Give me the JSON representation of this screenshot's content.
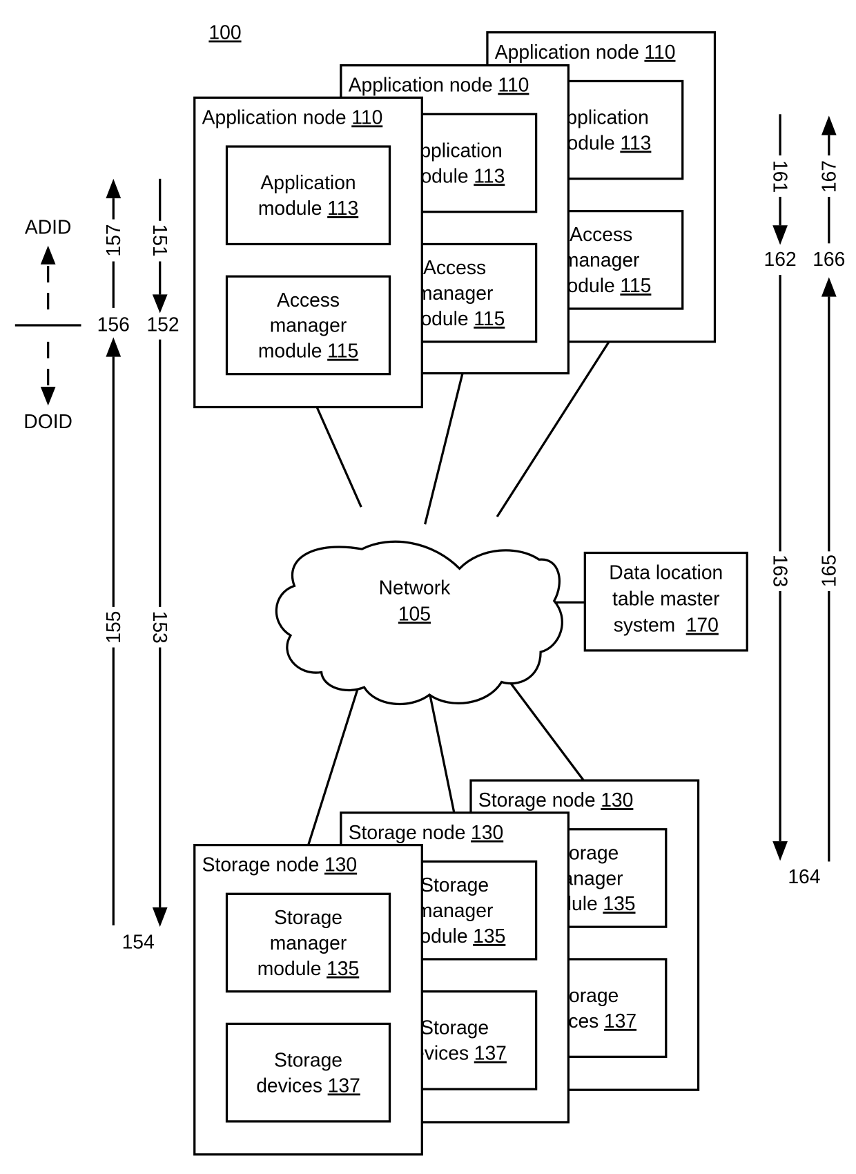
{
  "figure": {
    "figure_ref": "100",
    "application_nodes": [
      {
        "title": "Application node",
        "ref": "110",
        "modules": [
          {
            "lines": [
              "Application",
              "module"
            ],
            "ref": "113"
          },
          {
            "lines": [
              "Access",
              "manager",
              "module"
            ],
            "ref": "115"
          }
        ]
      },
      {
        "title": "Application node",
        "ref": "110",
        "modules": [
          {
            "lines": [
              "Application",
              "module"
            ],
            "ref": "113"
          },
          {
            "lines": [
              "Access",
              "manager",
              "module"
            ],
            "ref": "115"
          }
        ]
      },
      {
        "title": "Application node",
        "ref": "110",
        "modules": [
          {
            "lines": [
              "Application",
              "module"
            ],
            "ref": "113"
          },
          {
            "lines": [
              "Access",
              "manager",
              "module"
            ],
            "ref": "115"
          }
        ]
      }
    ],
    "network": {
      "label": "Network",
      "ref": "105"
    },
    "data_location": {
      "lines": [
        "Data location",
        "table master",
        "system"
      ],
      "ref": "170"
    },
    "storage_nodes": [
      {
        "title": "Storage node",
        "ref": "130",
        "modules": [
          {
            "lines": [
              "Storage",
              "manager",
              "module"
            ],
            "ref": "135"
          },
          {
            "lines": [
              "Storage",
              "devices"
            ],
            "ref": "137"
          }
        ]
      },
      {
        "title": "Storage node",
        "ref": "130",
        "modules": [
          {
            "lines": [
              "Storage",
              "manager",
              "module"
            ],
            "ref": "135"
          },
          {
            "lines": [
              "Storage",
              "devices"
            ],
            "ref": "137"
          }
        ]
      },
      {
        "title": "Storage node",
        "ref": "130",
        "modules": [
          {
            "lines": [
              "Storage",
              "manager",
              "module"
            ],
            "ref": "135"
          },
          {
            "lines": [
              "Storage",
              "devices"
            ],
            "ref": "137"
          }
        ]
      }
    ],
    "legend": {
      "up_label": "ADID",
      "down_label": "DOID"
    },
    "left_arrows": {
      "a151": "151",
      "a152": "152",
      "a153": "153",
      "a154": "154",
      "a155": "155",
      "a156": "156",
      "a157": "157"
    },
    "right_arrows": {
      "a161": "161",
      "a162": "162",
      "a163": "163",
      "a164": "164",
      "a165": "165",
      "a166": "166",
      "a167": "167"
    }
  }
}
